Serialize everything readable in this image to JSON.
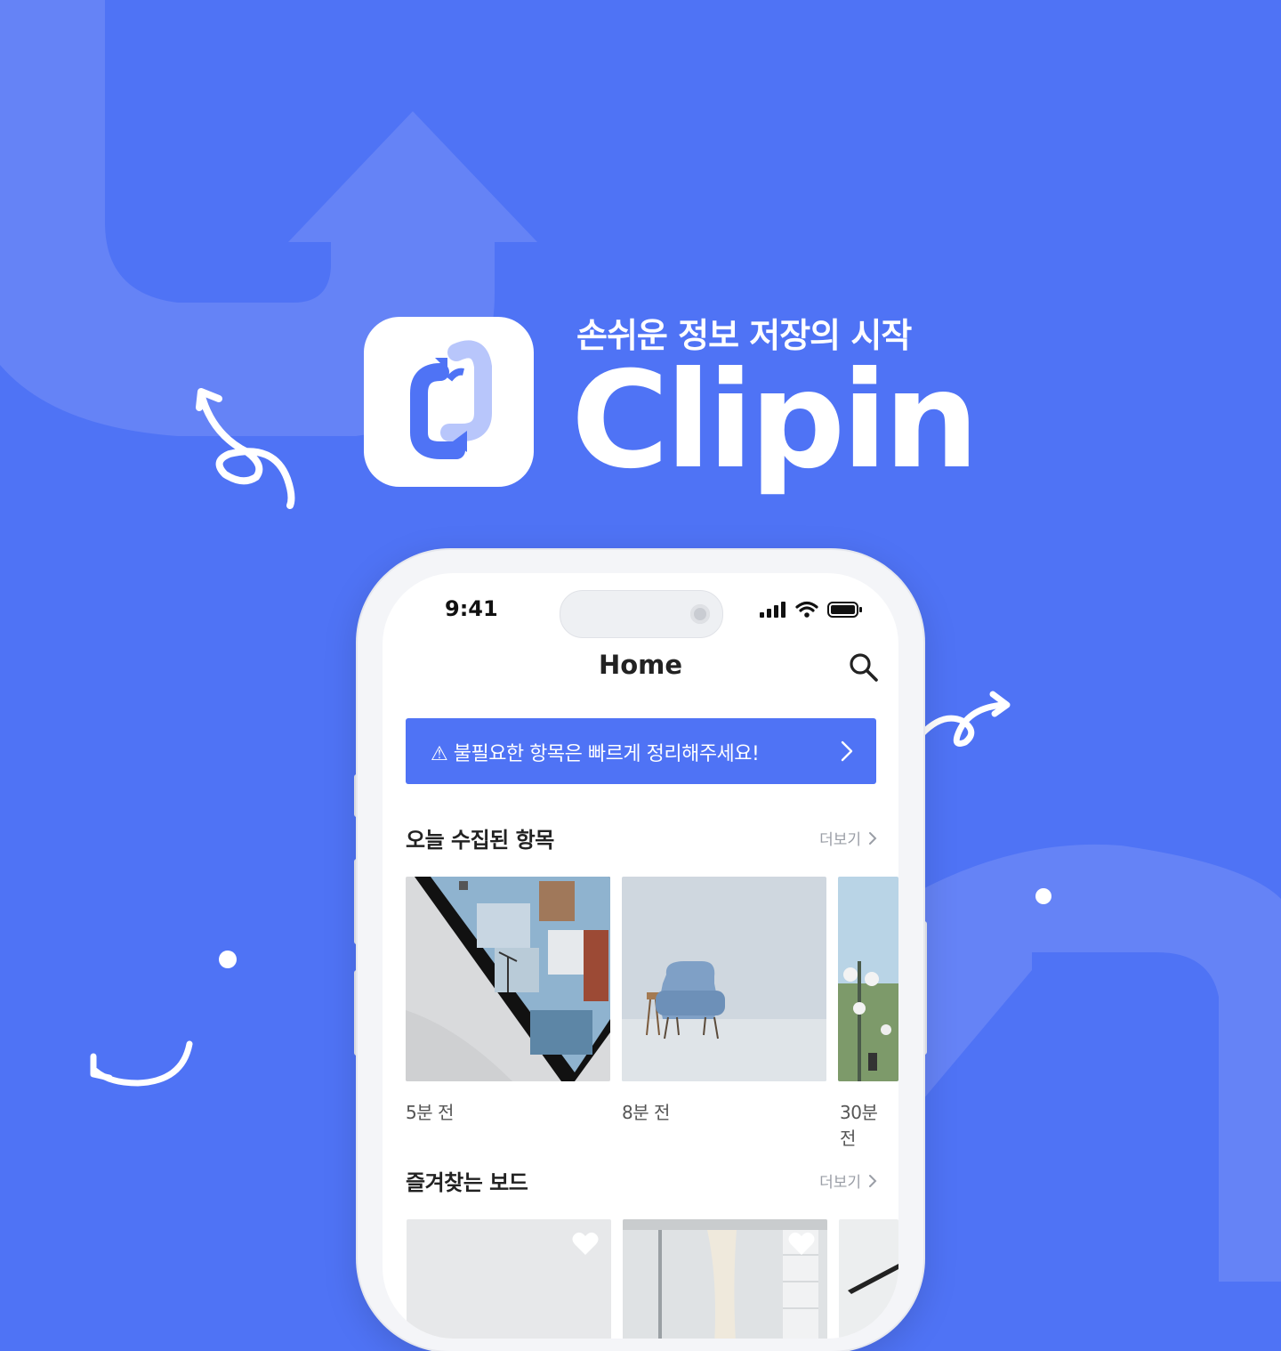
{
  "colors": {
    "background": "#4f73f5",
    "accent": "#4f73f5",
    "white": "#ffffff",
    "text_dark": "#222222",
    "text_muted": "#9a9ea6"
  },
  "branding": {
    "tagline": "손쉬운 정보 저장의 시작",
    "name": "Clipin"
  },
  "status_bar": {
    "time": "9:41"
  },
  "nav": {
    "title": "Home"
  },
  "notice": {
    "text": "⚠ 불필요한 항목은 빠르게 정리해주세요!"
  },
  "today_section": {
    "title": "오늘 수집된 항목",
    "more_label": "더보기",
    "items": [
      {
        "label": "5분 전"
      },
      {
        "label": "8분 전"
      },
      {
        "label": "30분 전"
      }
    ]
  },
  "favorites_section": {
    "title": "즐겨찾는 보드",
    "more_label": "더보기"
  }
}
